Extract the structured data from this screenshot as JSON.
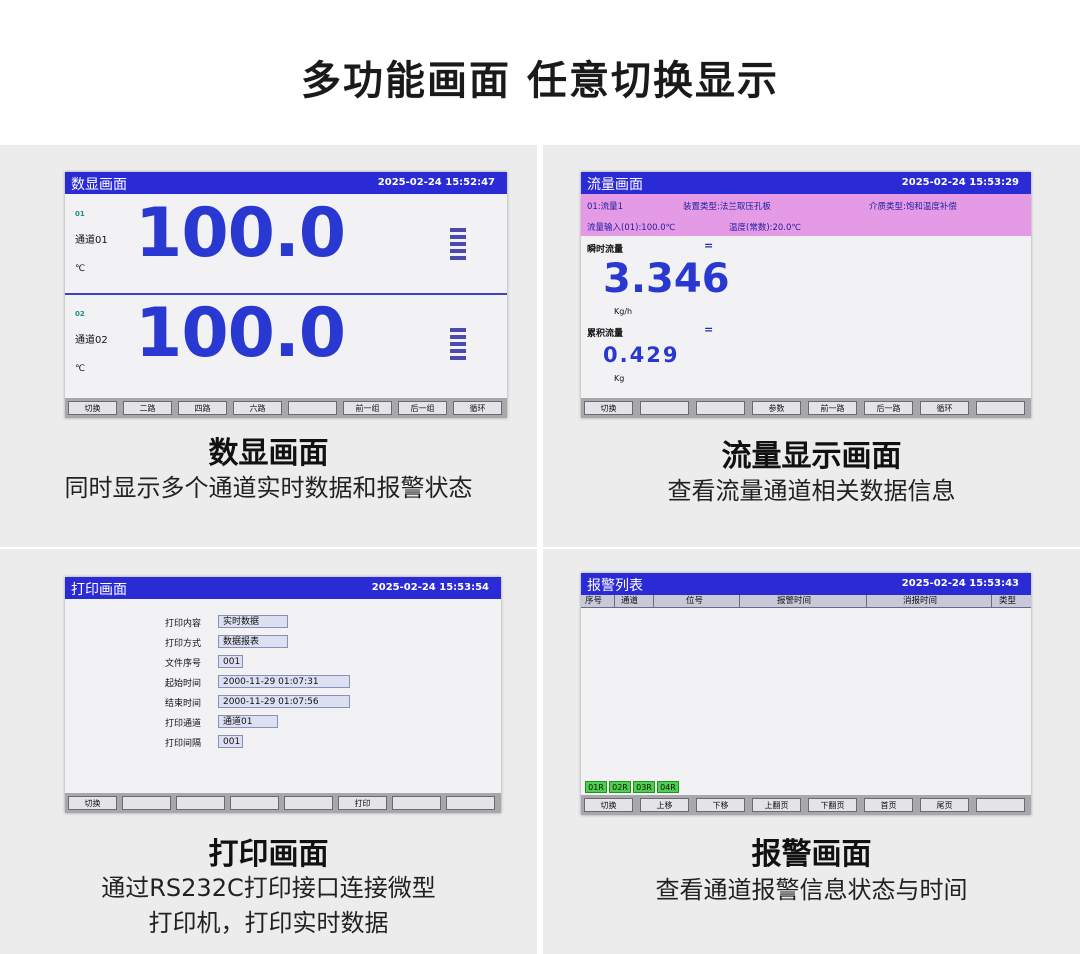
{
  "headline": "多功能画面  任意切换显示",
  "panels": {
    "numeric": {
      "caption_title": "数显画面",
      "caption_desc": "同时显示多个通道实时数据和报警状态",
      "screen": {
        "title": "数显画面",
        "datetime": "2025-02-24 15:52:47",
        "channels": [
          {
            "no": "01",
            "name": "通道01",
            "unit": "℃",
            "value": "100.0"
          },
          {
            "no": "02",
            "name": "通道02",
            "unit": "℃",
            "value": "100.0"
          }
        ],
        "softkeys": [
          "切换",
          "二路",
          "四路",
          "六路",
          "",
          "前一组",
          "后一组",
          "循环"
        ]
      }
    },
    "flow": {
      "caption_title": "流量显示画面",
      "caption_desc": "查看流量通道相关数据信息",
      "screen": {
        "title": "流量画面",
        "datetime": "2025-02-24 15:53:29",
        "info_channel": "01:流量1",
        "info_device": "装置类型:法兰取压孔板",
        "info_medium": "介质类型:饱和温度补偿",
        "info_input": "流量输入(01):100.0℃",
        "info_temp": "温度(常数):20.0℃",
        "instant_label": "瞬时流量",
        "instant_eq": "=",
        "instant_value": "3.346",
        "instant_unit": "Kg/h",
        "total_label": "累积流量",
        "total_eq": "=",
        "total_value": "0.429",
        "total_unit": "Kg",
        "softkeys": [
          "切换",
          "",
          "",
          "参数",
          "前一路",
          "后一路",
          "循环",
          ""
        ]
      }
    },
    "print": {
      "caption_title": "打印画面",
      "caption_desc_1": "通过RS232C打印接口连接微型",
      "caption_desc_2": "打印机，打印实时数据",
      "screen": {
        "title": "打印画面",
        "datetime": "2025-02-24 15:53:54",
        "rows": [
          {
            "key": "打印内容",
            "value": "实时数据"
          },
          {
            "key": "打印方式",
            "value": "数据报表"
          },
          {
            "key": "文件序号",
            "value": "001"
          },
          {
            "key": "起始时间",
            "value": "2000-11-29 01:07:31"
          },
          {
            "key": "结束时间",
            "value": "2000-11-29 01:07:56"
          },
          {
            "key": "打印通道",
            "value": "通道01"
          },
          {
            "key": "打印间隔",
            "value": "001"
          }
        ],
        "softkeys": [
          "切换",
          "",
          "",
          "",
          "",
          "打印",
          "",
          ""
        ]
      }
    },
    "alarm": {
      "caption_title": "报警画面",
      "caption_desc": "查看通道报警信息状态与时间",
      "screen": {
        "title": "报警列表",
        "datetime": "2025-02-24 15:53:43",
        "columns": [
          "序号",
          "通道",
          "位号",
          "报警时间",
          "消报时间",
          "类型"
        ],
        "tags": [
          "01R",
          "02R",
          "03R",
          "04R"
        ],
        "softkeys": [
          "切换",
          "上移",
          "下移",
          "上翻页",
          "下翻页",
          "首页",
          "尾页",
          ""
        ]
      }
    }
  }
}
